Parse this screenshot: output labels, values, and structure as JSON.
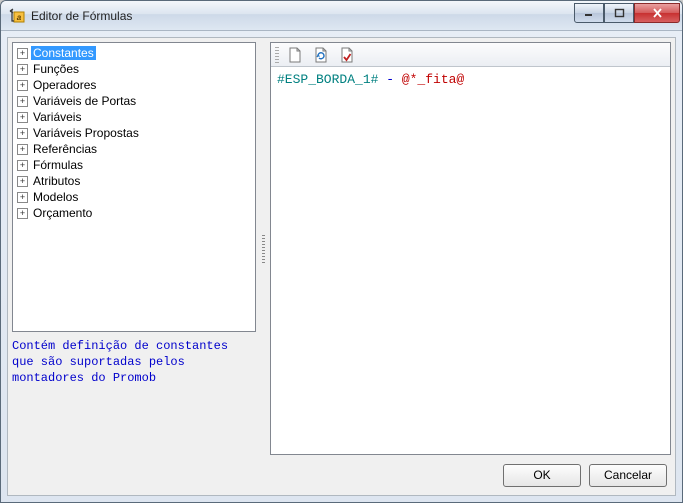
{
  "window": {
    "title": "Editor de Fórmulas"
  },
  "tree": {
    "items": [
      {
        "label": "Constantes",
        "selected": true
      },
      {
        "label": "Funções"
      },
      {
        "label": "Operadores"
      },
      {
        "label": "Variáveis de Portas"
      },
      {
        "label": "Variáveis"
      },
      {
        "label": "Variáveis Propostas"
      },
      {
        "label": "Referências"
      },
      {
        "label": "Fórmulas"
      },
      {
        "label": "Atributos"
      },
      {
        "label": "Modelos"
      },
      {
        "label": "Orçamento"
      }
    ]
  },
  "description": {
    "text": "Contém definição de constantes que são suportadas pelos montadores do Promob"
  },
  "editor": {
    "tokens": [
      {
        "text": "#ESP_BORDA_1#",
        "cls": "tok-teal"
      },
      {
        "text": " - ",
        "cls": "tok-blue"
      },
      {
        "text": "@*_fita@",
        "cls": "tok-red"
      }
    ]
  },
  "buttons": {
    "ok": "OK",
    "cancel": "Cancelar"
  }
}
